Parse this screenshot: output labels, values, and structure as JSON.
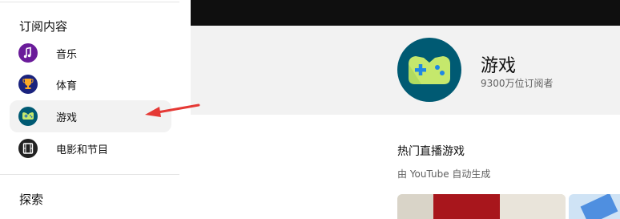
{
  "sidebar": {
    "section_title": "订阅内容",
    "items": [
      {
        "label": "音乐",
        "icon": "music-note-icon",
        "color": "#6a1b9a"
      },
      {
        "label": "体育",
        "icon": "trophy-icon",
        "color": "#1a237e"
      },
      {
        "label": "游戏",
        "icon": "gamepad-icon",
        "color": "#005a73",
        "active": true
      },
      {
        "label": "电影和节目",
        "icon": "film-icon",
        "color": "#212121"
      }
    ],
    "explore_title": "探索"
  },
  "channel": {
    "name": "游戏",
    "subscribers": "9300万位订阅者",
    "avatar_color": "#005a73"
  },
  "shelf": {
    "title": "热门直播游戏",
    "subtitle": "由 YouTube 自动生成"
  },
  "annotation": {
    "color": "#e53935"
  }
}
